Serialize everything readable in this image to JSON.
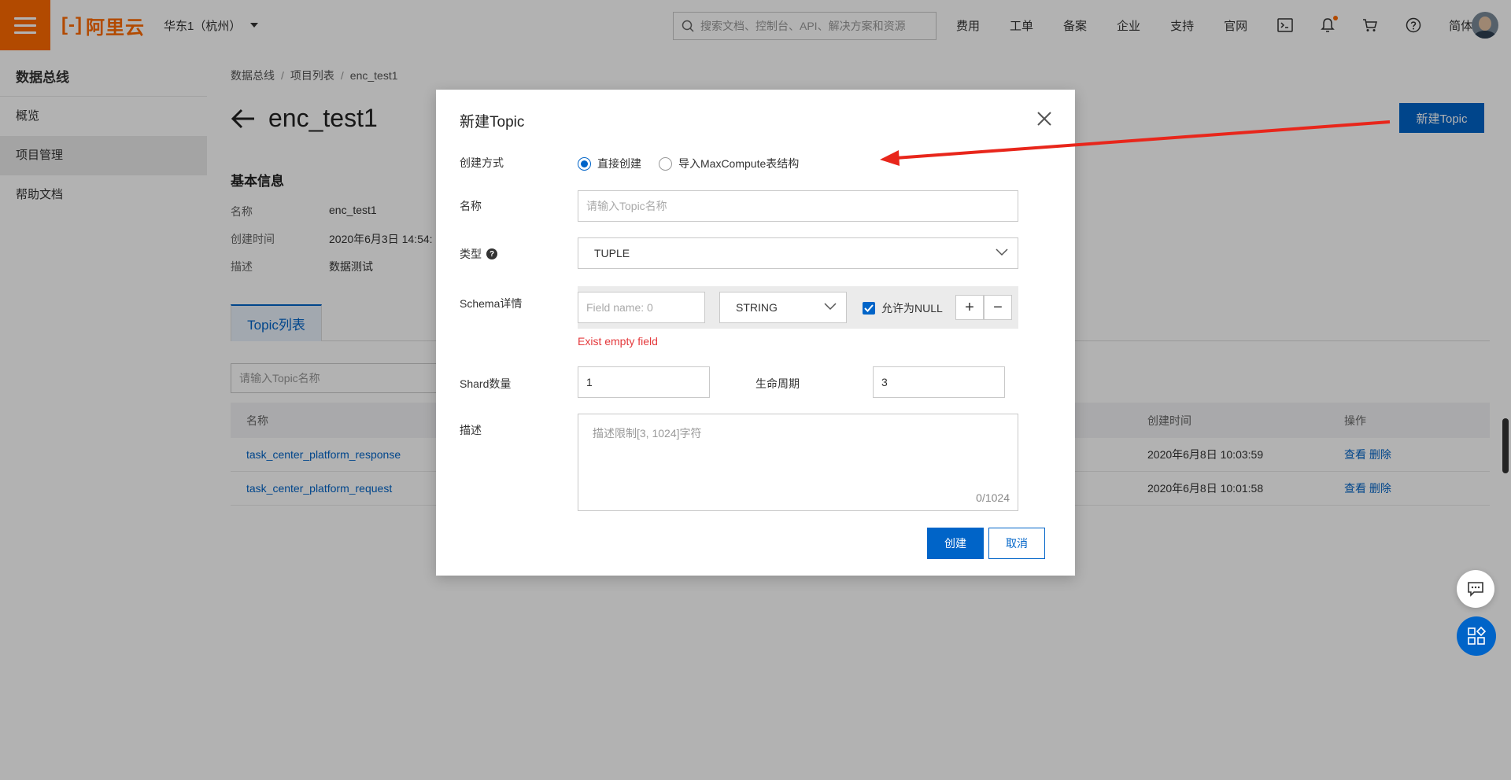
{
  "topbar": {
    "logo_text": "阿里云",
    "region": "华东1（杭州）",
    "search_placeholder": "搜索文档、控制台、API、解决方案和资源",
    "nav": [
      "费用",
      "工单",
      "备案",
      "企业",
      "支持",
      "官网"
    ],
    "language": "简体",
    "icons": [
      "terminal-icon",
      "bell-icon",
      "cart-icon",
      "help-icon"
    ]
  },
  "sidebar": {
    "title": "数据总线",
    "items": [
      {
        "label": "概览",
        "active": false
      },
      {
        "label": "项目管理",
        "active": true
      },
      {
        "label": "帮助文档",
        "active": false
      }
    ]
  },
  "main": {
    "breadcrumb": [
      "数据总线",
      "项目列表",
      "enc_test1"
    ],
    "title": "enc_test1",
    "new_topic_label": "新建Topic",
    "basic_info_title": "基本信息",
    "info": [
      {
        "label": "名称",
        "value": "enc_test1"
      },
      {
        "label": "创建时间",
        "value": "2020年6月3日 14:54:"
      },
      {
        "label": "描述",
        "value": "数据测试"
      }
    ],
    "tab_label": "Topic列表",
    "list_search_placeholder": "请输入Topic名称",
    "table": {
      "headers": {
        "name": "名称",
        "created": "创建时间",
        "ops": "操作"
      },
      "rows": [
        {
          "name": "task_center_platform_response",
          "created": "2020年6月8日 10:03:59",
          "view": "查看",
          "delete": "删除"
        },
        {
          "name": "task_center_platform_request",
          "created": "2020年6月8日 10:01:58",
          "view": "查看",
          "delete": "删除"
        }
      ]
    }
  },
  "modal": {
    "title": "新建Topic",
    "create_mode_label": "创建方式",
    "mode_direct": "直接创建",
    "mode_import": "导入MaxCompute表结构",
    "name_label": "名称",
    "name_placeholder": "请输入Topic名称",
    "type_label": "类型",
    "type_value": "TUPLE",
    "schema_label": "Schema详情",
    "field_placeholder": "Field name: 0",
    "field_type": "STRING",
    "allow_null_label": "允许为NULL",
    "error_text": "Exist empty field",
    "shard_label": "Shard数量",
    "shard_value": "1",
    "lifecycle_label": "生命周期",
    "lifecycle_value": "3",
    "desc_label": "描述",
    "desc_placeholder": "描述限制[3, 1024]字符",
    "desc_count": "0/1024",
    "create_btn": "创建",
    "cancel_btn": "取消"
  },
  "colors": {
    "brand": "#ff6a00",
    "primary": "#0064c8",
    "error": "#e4393c",
    "annotation_arrow": "#e8261b"
  }
}
